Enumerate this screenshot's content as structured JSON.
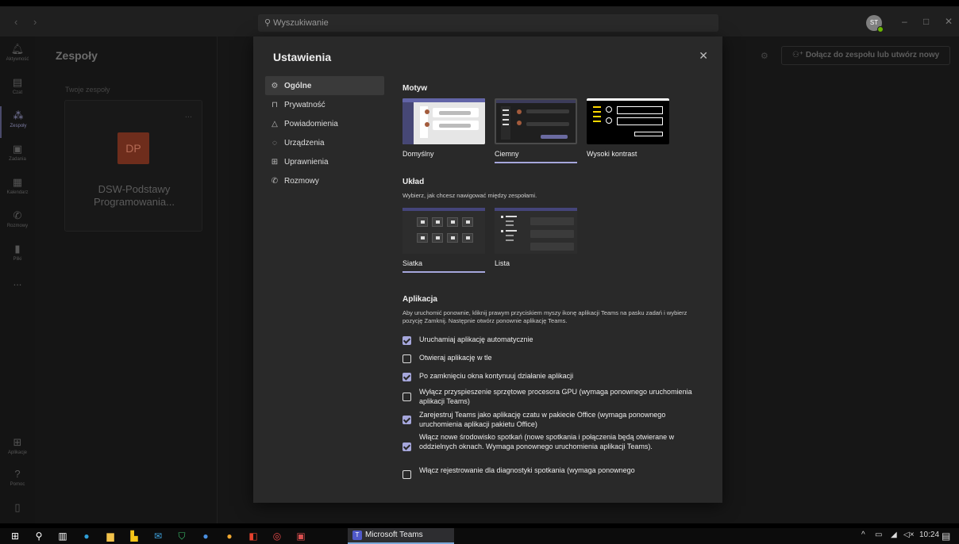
{
  "app": {
    "search_placeholder": "Wyszukiwanie",
    "avatar_initials": "ST"
  },
  "rail": {
    "items": [
      {
        "label": "Aktywność",
        "icon": "bell-icon"
      },
      {
        "label": "Czat",
        "icon": "chat-icon"
      },
      {
        "label": "Zespoły",
        "icon": "teams-icon"
      },
      {
        "label": "Zadania",
        "icon": "assignments-icon"
      },
      {
        "label": "Kalendarz",
        "icon": "calendar-icon"
      },
      {
        "label": "Rozmowy",
        "icon": "phone-icon"
      },
      {
        "label": "Pliki",
        "icon": "file-icon"
      }
    ],
    "more": "...",
    "apps_label": "Aplikacje",
    "help_label": "Pomoc"
  },
  "teams": {
    "header": "Zespoły",
    "subheader": "Twoje zespoły",
    "card": {
      "initials": "DP",
      "name": "DSW-Podstawy Programowania...",
      "more": "..."
    },
    "join_button": "Dołącz do zespołu lub utwórz nowy"
  },
  "settings": {
    "title": "Ustawienia",
    "menu": [
      {
        "label": "Ogólne",
        "icon": "gear-icon",
        "active": true
      },
      {
        "label": "Prywatność",
        "icon": "lock-icon",
        "active": false
      },
      {
        "label": "Powiadomienia",
        "icon": "bell-icon",
        "active": false
      },
      {
        "label": "Urządzenia",
        "icon": "device-icon",
        "active": false
      },
      {
        "label": "Uprawnienia",
        "icon": "apps-icon",
        "active": false
      },
      {
        "label": "Rozmowy",
        "icon": "phone-icon",
        "active": false
      }
    ],
    "theme": {
      "title": "Motyw",
      "options": [
        {
          "label": "Domyślny",
          "selected": false
        },
        {
          "label": "Ciemny",
          "selected": true
        },
        {
          "label": "Wysoki kontrast",
          "selected": false
        }
      ]
    },
    "layout": {
      "title": "Układ",
      "description": "Wybierz, jak chcesz nawigować między zespołami.",
      "options": [
        {
          "label": "Siatka",
          "selected": true
        },
        {
          "label": "Lista",
          "selected": false
        }
      ]
    },
    "application": {
      "title": "Aplikacja",
      "description": "Aby uruchomić ponownie, kliknij prawym przyciskiem myszy ikonę aplikacji Teams na pasku zadań i wybierz pozycję Zamknij. Następnie otwórz ponownie aplikację Teams.",
      "options": [
        {
          "label": "Uruchamiaj aplikację automatycznie",
          "checked": true
        },
        {
          "label": "Otwieraj aplikację w tle",
          "checked": false
        },
        {
          "label": "Po zamknięciu okna kontynuuj działanie aplikacji",
          "checked": true
        },
        {
          "label": "Wyłącz przyspieszenie sprzętowe procesora GPU (wymaga ponownego uruchomienia aplikacji Teams)",
          "checked": false
        },
        {
          "label": "Zarejestruj Teams jako aplikację czatu w pakiecie Office (wymaga ponownego uruchomienia aplikacji pakietu Office)",
          "checked": true
        },
        {
          "label": "Włącz nowe środowisko spotkań (nowe spotkania i połączenia będą otwierane w oddzielnych oknach. Wymaga ponownego uruchomienia aplikacji Teams).",
          "checked": true
        },
        {
          "label": "Włącz rejestrowanie dla diagnostyki spotkania (wymaga ponownego",
          "checked": false
        }
      ]
    },
    "close_icon": "close-icon"
  },
  "taskbar": {
    "active_app": "Microsoft Teams",
    "time": "10:24"
  },
  "colors": {
    "accent": "#a6a7dc",
    "modal_bg": "#292929"
  }
}
